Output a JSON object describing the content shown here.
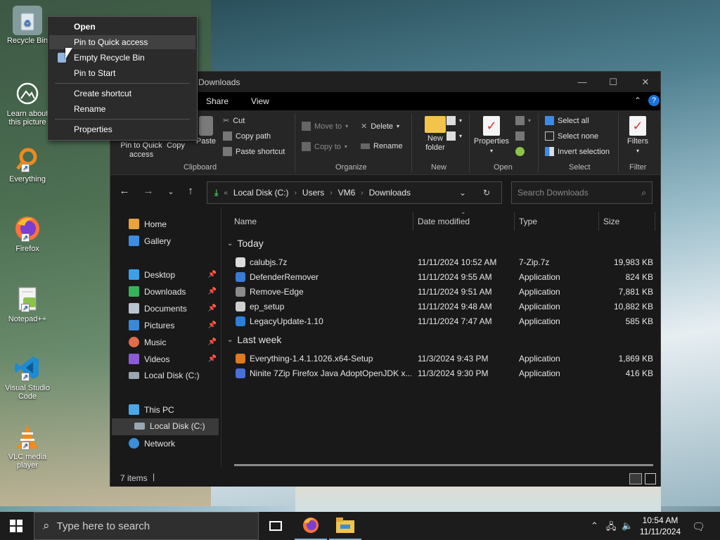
{
  "desktop": {
    "icons": [
      {
        "label": "Recycle Bin",
        "icon": "recycle-bin-icon"
      },
      {
        "label": "Learn about this picture",
        "icon": "learn-picture-icon"
      },
      {
        "label": "Everything",
        "icon": "everything-search-icon"
      },
      {
        "label": "Firefox",
        "icon": "firefox-icon"
      },
      {
        "label": "Notepad++",
        "icon": "notepad-plus-plus-icon"
      },
      {
        "label": "Visual Studio Code",
        "icon": "vscode-icon"
      },
      {
        "label": "VLC media player",
        "icon": "vlc-icon"
      }
    ]
  },
  "context_menu": {
    "items": [
      {
        "label": "Open"
      },
      {
        "label": "Pin to Quick access"
      },
      {
        "label": "Empty Recycle Bin"
      },
      {
        "label": "Pin to Start"
      },
      {
        "label": "Create shortcut"
      },
      {
        "label": "Rename"
      },
      {
        "label": "Properties"
      }
    ]
  },
  "window": {
    "title": "Downloads",
    "menu": [
      "Share",
      "View"
    ],
    "ribbon": {
      "clipboard": {
        "label": "Clipboard",
        "pin": "Pin to Quick access",
        "copy": "Copy",
        "paste": "Paste",
        "cut": "Cut",
        "copy_path": "Copy path",
        "paste_shortcut": "Paste shortcut"
      },
      "organize": {
        "label": "Organize",
        "move_to": "Move to",
        "copy_to": "Copy to",
        "delete": "Delete",
        "rename": "Rename"
      },
      "new": {
        "label": "New",
        "new_folder": "New folder"
      },
      "open": {
        "label": "Open",
        "properties": "Properties"
      },
      "select": {
        "label": "Select",
        "select_all": "Select all",
        "select_none": "Select none",
        "invert_selection": "Invert selection"
      },
      "filter": {
        "label": "Filter",
        "filters": "Filters"
      }
    },
    "address": {
      "crumbs": [
        "Local Disk (C:)",
        "Users",
        "VM6",
        "Downloads"
      ],
      "search_placeholder": "Search Downloads"
    },
    "nav": {
      "items": [
        {
          "label": "Home",
          "pinned": false
        },
        {
          "label": "Gallery",
          "pinned": false
        },
        {
          "label": "Desktop",
          "pinned": true
        },
        {
          "label": "Downloads",
          "pinned": true
        },
        {
          "label": "Documents",
          "pinned": true
        },
        {
          "label": "Pictures",
          "pinned": true
        },
        {
          "label": "Music",
          "pinned": true
        },
        {
          "label": "Videos",
          "pinned": true
        },
        {
          "label": "Local Disk (C:)",
          "pinned": false
        },
        {
          "label": "This PC",
          "pinned": false
        },
        {
          "label": "Local Disk (C:)",
          "pinned": false
        },
        {
          "label": "Network",
          "pinned": false
        }
      ]
    },
    "columns": {
      "name": "Name",
      "date": "Date modified",
      "type": "Type",
      "size": "Size"
    },
    "groups": [
      {
        "label": "Today",
        "files": [
          {
            "name": "calubjs.7z",
            "date": "11/11/2024 10:52 AM",
            "type": "7-Zip.7z",
            "size": "19,983 KB",
            "color": "#dcdcdc"
          },
          {
            "name": "DefenderRemover",
            "date": "11/11/2024 9:55 AM",
            "type": "Application",
            "size": "824 KB",
            "color": "#3a7bd5"
          },
          {
            "name": "Remove-Edge",
            "date": "11/11/2024 9:51 AM",
            "type": "Application",
            "size": "7,881 KB",
            "color": "#8a8a8a"
          },
          {
            "name": "ep_setup",
            "date": "11/11/2024 9:48 AM",
            "type": "Application",
            "size": "10,882 KB",
            "color": "#cfcfcf"
          },
          {
            "name": "LegacyUpdate-1.10",
            "date": "11/11/2024 7:47 AM",
            "type": "Application",
            "size": "585 KB",
            "color": "#2d7fd8"
          }
        ]
      },
      {
        "label": "Last week",
        "files": [
          {
            "name": "Everything-1.4.1.1026.x64-Setup",
            "date": "11/3/2024 9:43 PM",
            "type": "Application",
            "size": "1,869 KB",
            "color": "#e07a1f"
          },
          {
            "name": "Ninite 7Zip Firefox Java AdoptOpenJDK x...",
            "date": "11/3/2024 9:30 PM",
            "type": "Application",
            "size": "416 KB",
            "color": "#4a6fd8"
          }
        ]
      }
    ],
    "status": {
      "count": "7 items"
    }
  },
  "taskbar": {
    "search_placeholder": "Type here to search",
    "time": "10:54 AM",
    "date": "11/11/2024"
  },
  "colors": {
    "accent": "#0078d4",
    "window_bg": "#191919",
    "ribbon_bg": "#262626",
    "menubar_bg": "#000000"
  }
}
